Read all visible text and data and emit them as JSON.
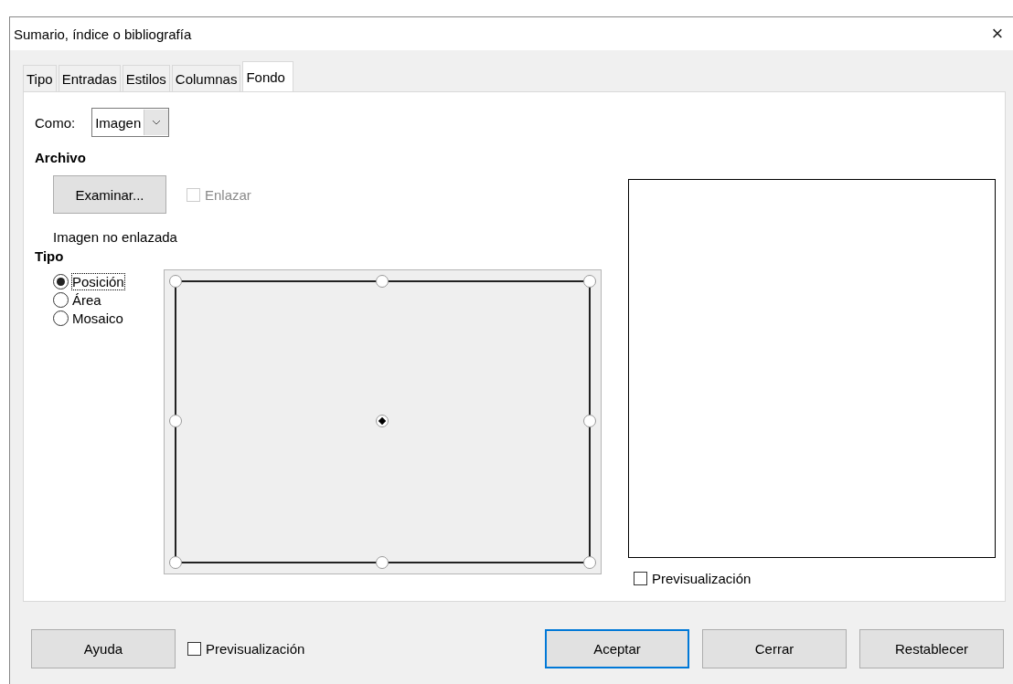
{
  "window": {
    "title": "Sumario, índice o bibliografía",
    "close": "×"
  },
  "tabs": [
    {
      "label": "Tipo",
      "selected": false
    },
    {
      "label": "Entradas",
      "selected": false
    },
    {
      "label": "Estilos",
      "selected": false
    },
    {
      "label": "Columnas",
      "selected": false
    },
    {
      "label": "Fondo",
      "selected": true
    }
  ],
  "como": {
    "label": "Como:",
    "value": "Imagen"
  },
  "archivo": {
    "heading": "Archivo",
    "browse_button": "Examinar...",
    "link": {
      "label": "Enlazar",
      "checked": false,
      "disabled": true
    },
    "status": "Imagen no enlazada"
  },
  "tipo": {
    "heading": "Tipo",
    "options": [
      {
        "label": "Posición",
        "selected": true
      },
      {
        "label": "Área",
        "selected": false
      },
      {
        "label": "Mosaico",
        "selected": false
      }
    ]
  },
  "position_grid": [
    {
      "selected": false
    },
    {
      "selected": false
    },
    {
      "selected": false
    },
    {
      "selected": false
    },
    {
      "selected": true
    },
    {
      "selected": false
    },
    {
      "selected": false
    },
    {
      "selected": false
    },
    {
      "selected": false
    }
  ],
  "preview": {
    "label": "Previsualización",
    "checked": false
  },
  "footer": {
    "help_button": "Ayuda",
    "preview": {
      "label": "Previsualización",
      "checked": false
    },
    "buttons": [
      {
        "label": "Aceptar",
        "focused": true
      },
      {
        "label": "Cerrar",
        "focused": false
      },
      {
        "label": "Restablecer",
        "focused": false
      }
    ]
  }
}
